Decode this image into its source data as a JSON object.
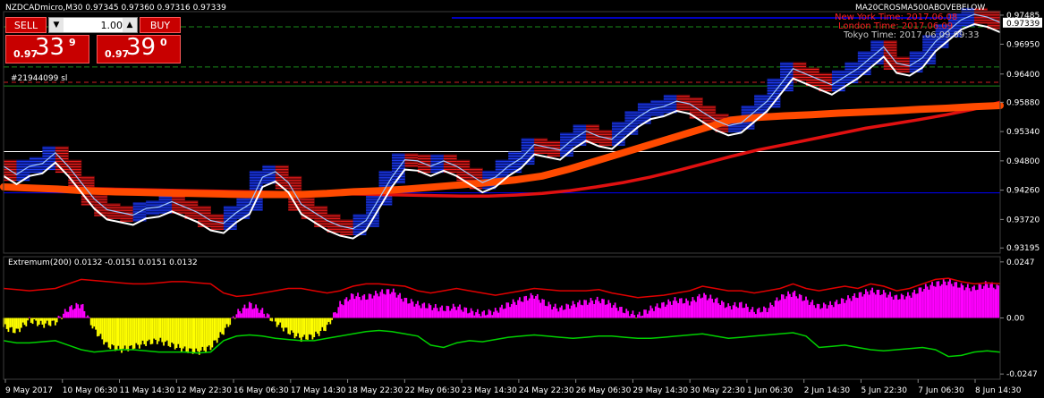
{
  "colors": {
    "background": "#000000",
    "candle_up": "#2040ff",
    "candle_down": "#ff2020",
    "ma_fast": "#ff4a00",
    "ma_slow": "#e01010",
    "envelope_line": "#ffffff",
    "grid_green": "#1a8a1a",
    "histogram_positive": "#ff00ff",
    "histogram_negative": "#ffff00",
    "extremum_upper": "#e00000",
    "extremum_lower": "#00d000",
    "ask_line": "#0000ff"
  },
  "header": {
    "symbol_line": "NZDCADmicro,M30  0.97345 0.97360 0.97316 0.97339",
    "indicator_name": "MA20CROSMA500ABOVEBELOW"
  },
  "clock": {
    "new_york": "New York Time: 2017.06.08",
    "london": "London  Time: 2017.06.09",
    "tokyo": "Tokyo   Time: 2017.06.09 09:33"
  },
  "trade_panel": {
    "sell_label": "SELL",
    "buy_label": "BUY",
    "lot_value": "1.00",
    "sell_price_prefix": "0.97",
    "sell_price_big": "33",
    "sell_price_sup": "9",
    "buy_price_prefix": "0.97",
    "buy_price_big": "39",
    "buy_price_sup": "0"
  },
  "order_label": "#21944099 sl",
  "icons": {
    "lot_down": "arrow-down-icon",
    "lot_up": "arrow-up-icon"
  },
  "chart_data": [
    {
      "type": "candlestick",
      "title": "NZDCADmicro,M30",
      "y_ticks": [
        "0.97485",
        "0.96950",
        "0.96400",
        "0.95880",
        "0.95340",
        "0.94800",
        "0.94260",
        "0.93720",
        "0.93195"
      ],
      "current_price_label": "0.97339",
      "ylim": [
        0.931,
        0.9755
      ],
      "x_ticks": [
        "9 May 2017",
        "10 May 06:30",
        "11 May 14:30",
        "12 May 22:30",
        "16 May 06:30",
        "17 May 14:30",
        "18 May 22:30",
        "22 May 06:30",
        "23 May 14:30",
        "24 May 22:30",
        "26 May 06:30",
        "29 May 14:30",
        "30 May 22:30",
        "1 Jun 06:30",
        "2 Jun 14:30",
        "5 Jun 22:30",
        "7 Jun 06:30",
        "8 Jun 14:30"
      ],
      "price_path": [
        0.947,
        0.9455,
        0.947,
        0.9475,
        0.9495,
        0.947,
        0.944,
        0.941,
        0.939,
        0.9385,
        0.938,
        0.9392,
        0.9395,
        0.9405,
        0.9395,
        0.9385,
        0.937,
        0.9365,
        0.9385,
        0.94,
        0.945,
        0.946,
        0.944,
        0.94,
        0.9385,
        0.937,
        0.936,
        0.9355,
        0.937,
        0.941,
        0.945,
        0.9482,
        0.948,
        0.947,
        0.948,
        0.947,
        0.9455,
        0.944,
        0.945,
        0.947,
        0.9485,
        0.951,
        0.9505,
        0.95,
        0.952,
        0.9535,
        0.9525,
        0.952,
        0.954,
        0.956,
        0.9575,
        0.958,
        0.959,
        0.9585,
        0.957,
        0.9555,
        0.9545,
        0.955,
        0.957,
        0.959,
        0.962,
        0.965,
        0.964,
        0.963,
        0.962,
        0.9635,
        0.965,
        0.967,
        0.969,
        0.966,
        0.9655,
        0.967,
        0.97,
        0.972,
        0.974,
        0.975,
        0.9745,
        0.9735
      ],
      "ma_fast_path": [
        0.9432,
        0.943,
        0.9428,
        0.9425,
        0.9423,
        0.9422,
        0.9421,
        0.942,
        0.9419,
        0.9418,
        0.9418,
        0.9418,
        0.942,
        0.9423,
        0.9425,
        0.9428,
        0.9432,
        0.9436,
        0.944,
        0.9445,
        0.9452,
        0.9465,
        0.948,
        0.9495,
        0.951,
        0.9525,
        0.954,
        0.9555,
        0.956,
        0.9563,
        0.9565,
        0.9568,
        0.957,
        0.9572,
        0.9575,
        0.9577,
        0.958,
        0.9582
      ],
      "ma_slow_path": [
        0.9432,
        0.9431,
        0.943,
        0.9429,
        0.9428,
        0.9427,
        0.9426,
        0.9425,
        0.9424,
        0.9423,
        0.9422,
        0.9421,
        0.942,
        0.9419,
        0.9418,
        0.9417,
        0.9416,
        0.9415,
        0.9415,
        0.9417,
        0.942,
        0.9425,
        0.9432,
        0.944,
        0.945,
        0.9462,
        0.9475,
        0.9488,
        0.95,
        0.951,
        0.952,
        0.953,
        0.954,
        0.9548,
        0.9556,
        0.9565,
        0.9575,
        0.9588
      ],
      "horizontal_levels": [
        0.9727,
        0.9653,
        0.9618,
        0.9421,
        0.931,
        0.9497
      ]
    },
    {
      "type": "area",
      "title": "Extremum(200) 0.0132 -0.0151 0.0151 0.0132",
      "y_ticks": [
        "0.0247",
        "0.00",
        "-0.0247"
      ],
      "ylim": [
        -0.027,
        0.027
      ],
      "series": [
        {
          "values": [
            -0.004,
            -0.006,
            -0.001,
            -0.003,
            -0.002,
            0.004,
            0.006,
            -0.005,
            -0.012,
            -0.014,
            -0.013,
            -0.011,
            -0.01,
            -0.012,
            -0.014,
            -0.015,
            -0.013,
            -0.006,
            0.002,
            0.006,
            0.003,
            -0.002,
            -0.006,
            -0.009,
            -0.008,
            -0.004,
            0.006,
            0.01,
            0.009,
            0.011,
            0.012,
            0.008,
            0.006,
            0.005,
            0.004,
            0.005,
            0.003,
            0.002,
            0.003,
            0.006,
            0.008,
            0.01,
            0.006,
            0.004,
            0.006,
            0.007,
            0.008,
            0.006,
            0.003,
            0.001,
            0.004,
            0.006,
            0.008,
            0.007,
            0.01,
            0.008,
            0.005,
            0.006,
            0.003,
            0.004,
            0.009,
            0.011,
            0.008,
            0.005,
            0.006,
            0.008,
            0.01,
            0.012,
            0.011,
            0.009,
            0.01,
            0.013,
            0.015,
            0.016,
            0.014,
            0.013,
            0.015,
            0.0132
          ]
        },
        {
          "values": [
            0.013,
            0.0125,
            0.012,
            0.0125,
            0.013,
            0.015,
            0.017,
            0.0165,
            0.016,
            0.0155,
            0.015,
            0.015,
            0.0155,
            0.016,
            0.016,
            0.0155,
            0.015,
            0.011,
            0.0095,
            0.01,
            0.011,
            0.012,
            0.013,
            0.013,
            0.012,
            0.011,
            0.012,
            0.014,
            0.015,
            0.015,
            0.0145,
            0.014,
            0.012,
            0.011,
            0.012,
            0.013,
            0.012,
            0.011,
            0.01,
            0.011,
            0.012,
            0.013,
            0.0125,
            0.012,
            0.012,
            0.012,
            0.0125,
            0.011,
            0.01,
            0.009,
            0.0095,
            0.01,
            0.011,
            0.012,
            0.014,
            0.013,
            0.012,
            0.012,
            0.011,
            0.012,
            0.013,
            0.015,
            0.013,
            0.012,
            0.013,
            0.014,
            0.013,
            0.015,
            0.014,
            0.012,
            0.013,
            0.015,
            0.017,
            0.0175,
            0.016,
            0.015,
            0.0155,
            0.0151
          ]
        },
        {
          "values": [
            -0.01,
            -0.011,
            -0.011,
            -0.0105,
            -0.01,
            -0.012,
            -0.014,
            -0.015,
            -0.0145,
            -0.014,
            -0.014,
            -0.0145,
            -0.015,
            -0.015,
            -0.015,
            -0.0155,
            -0.015,
            -0.01,
            -0.008,
            -0.0075,
            -0.008,
            -0.009,
            -0.0095,
            -0.01,
            -0.01,
            -0.009,
            -0.008,
            -0.007,
            -0.006,
            -0.0055,
            -0.006,
            -0.007,
            -0.008,
            -0.012,
            -0.013,
            -0.011,
            -0.01,
            -0.0105,
            -0.0095,
            -0.0085,
            -0.008,
            -0.0075,
            -0.008,
            -0.0085,
            -0.009,
            -0.0085,
            -0.008,
            -0.008,
            -0.0085,
            -0.009,
            -0.009,
            -0.0085,
            -0.008,
            -0.0075,
            -0.007,
            -0.008,
            -0.009,
            -0.0085,
            -0.008,
            -0.0075,
            -0.007,
            -0.0065,
            -0.008,
            -0.013,
            -0.0125,
            -0.012,
            -0.013,
            -0.014,
            -0.0145,
            -0.014,
            -0.0135,
            -0.013,
            -0.014,
            -0.017,
            -0.0165,
            -0.015,
            -0.0145,
            -0.0151
          ]
        }
      ]
    }
  ]
}
